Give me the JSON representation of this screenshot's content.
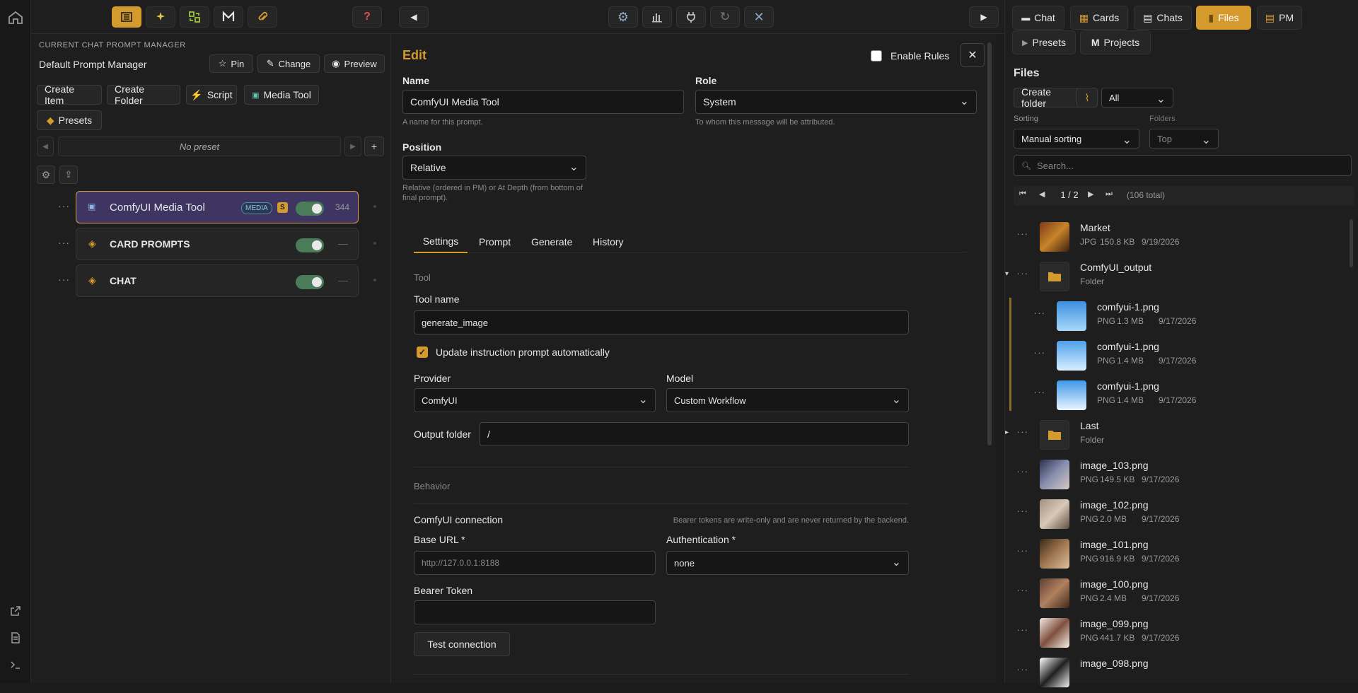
{
  "colors": {
    "accent": "#d49a2e",
    "toggle_on": "#4a7c59",
    "selected_item": "#3e3563"
  },
  "left_panel": {
    "header_label": "CURRENT CHAT PROMPT MANAGER",
    "manager_name": "Default Prompt Manager",
    "pin": "Pin",
    "change": "Change",
    "preview": "Preview",
    "create_item": "Create Item",
    "create_folder": "Create Folder",
    "script": "Script",
    "media_tool": "Media Tool",
    "presets": "Presets",
    "preset_select": "No preset",
    "items": [
      {
        "label": "ComfyUI Media Tool",
        "badge": "MEDIA",
        "badge2": "S",
        "count": "344"
      },
      {
        "label": "CARD PROMPTS",
        "dash": "—"
      },
      {
        "label": "CHAT",
        "dash": "—"
      }
    ]
  },
  "edit": {
    "title": "Edit",
    "enable_rules": "Enable Rules",
    "name_label": "Name",
    "name_value": "ComfyUI Media Tool",
    "name_hint": "A name for this prompt.",
    "role_label": "Role",
    "role_value": "System",
    "role_hint": "To whom this message will be attributed.",
    "position_label": "Position",
    "position_value": "Relative",
    "position_hint": "Relative (ordered in PM) or At Depth (from bottom of final prompt).",
    "tabs": [
      "Settings",
      "Prompt",
      "Generate",
      "History"
    ],
    "tool_section": "Tool",
    "tool_name_label": "Tool name",
    "tool_name_value": "generate_image",
    "update_checkbox": "Update instruction prompt automatically",
    "provider_label": "Provider",
    "provider_value": "ComfyUI",
    "model_label": "Model",
    "model_value": "Custom Workflow",
    "output_label": "Output folder",
    "output_value": "/",
    "behavior": "Behavior",
    "conn_label": "ComfyUI connection",
    "conn_hint": "Bearer tokens are write-only and are never returned by the backend.",
    "base_url_label": "Base URL *",
    "base_url_placeholder": "http://127.0.0.1:8188",
    "auth_label": "Authentication *",
    "auth_value": "none",
    "bearer_label": "Bearer Token",
    "test_button": "Test connection"
  },
  "right_panel": {
    "tabs": [
      "Chat",
      "Cards",
      "Chats",
      "Files",
      "PM"
    ],
    "tabs2": [
      "Presets",
      "Projects"
    ],
    "title": "Files",
    "create_folder": "Create folder",
    "filter": "All",
    "sorting_label": "Sorting",
    "sorting_value": "Manual sorting",
    "folders_label": "Folders",
    "folders_value": "Top",
    "search_placeholder": "Search...",
    "page": "1 / 2",
    "total": "(106 total)",
    "files": [
      {
        "name": "Market",
        "type": "JPG",
        "size": "150.8 KB",
        "date": "9/19/2026"
      },
      {
        "name": "ComfyUI_output",
        "type": "Folder"
      },
      {
        "name": "comfyui-1.png",
        "type": "PNG",
        "size": "1.3 MB",
        "date": "9/17/2026"
      },
      {
        "name": "comfyui-1.png",
        "type": "PNG",
        "size": "1.4 MB",
        "date": "9/17/2026"
      },
      {
        "name": "comfyui-1.png",
        "type": "PNG",
        "size": "1.4 MB",
        "date": "9/17/2026"
      },
      {
        "name": "Last",
        "type": "Folder"
      },
      {
        "name": "image_103.png",
        "type": "PNG",
        "size": "149.5 KB",
        "date": "9/17/2026"
      },
      {
        "name": "image_102.png",
        "type": "PNG",
        "size": "2.0 MB",
        "date": "9/17/2026"
      },
      {
        "name": "image_101.png",
        "type": "PNG",
        "size": "916.9 KB",
        "date": "9/17/2026"
      },
      {
        "name": "image_100.png",
        "type": "PNG",
        "size": "2.4 MB",
        "date": "9/17/2026"
      },
      {
        "name": "image_099.png",
        "type": "PNG",
        "size": "441.7 KB",
        "date": "9/17/2026"
      },
      {
        "name": "image_098.png"
      }
    ]
  }
}
